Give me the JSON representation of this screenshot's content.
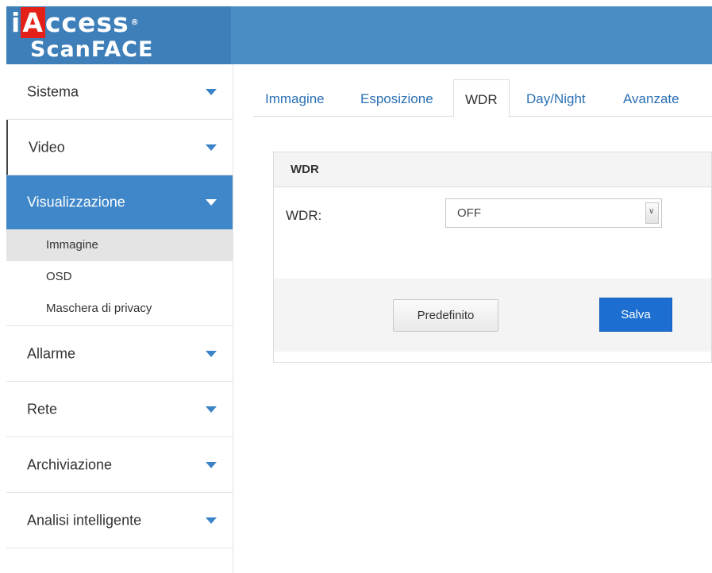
{
  "brand": {
    "logo_i": "i",
    "logo_a": "A",
    "logo_rest": "ccess",
    "logo_reg": "®",
    "product": "ScanFACE"
  },
  "sidebar": {
    "items": [
      {
        "label": "Sistema",
        "icon": "chevron-down-icon"
      },
      {
        "label": "Video",
        "icon": "chevron-down-icon"
      },
      {
        "label": "Visualizzazione",
        "icon": "chevron-down-icon",
        "active": true
      },
      {
        "label": "Allarme",
        "icon": "chevron-down-icon"
      },
      {
        "label": "Rete",
        "icon": "chevron-down-icon"
      },
      {
        "label": "Archiviazione",
        "icon": "chevron-down-icon"
      },
      {
        "label": "Analisi intelligente",
        "icon": "chevron-down-icon"
      }
    ],
    "submenu": [
      {
        "label": "Immagine",
        "active": true
      },
      {
        "label": "OSD"
      },
      {
        "label": "Maschera di privacy"
      }
    ]
  },
  "tabs": [
    {
      "label": "Immagine"
    },
    {
      "label": "Esposizione"
    },
    {
      "label": "WDR",
      "active": true
    },
    {
      "label": "Day/Night"
    },
    {
      "label": "Avanzate"
    }
  ],
  "panel": {
    "title": "WDR",
    "field_label": "WDR:",
    "field_value": "OFF",
    "default_button": "Predefinito",
    "save_button": "Salva"
  },
  "colors": {
    "header": "#4a8cc4",
    "active_menu": "#3f87c8",
    "primary_button": "#1c6fd0",
    "link": "#2a6fb5",
    "logo_red": "#e32119"
  }
}
